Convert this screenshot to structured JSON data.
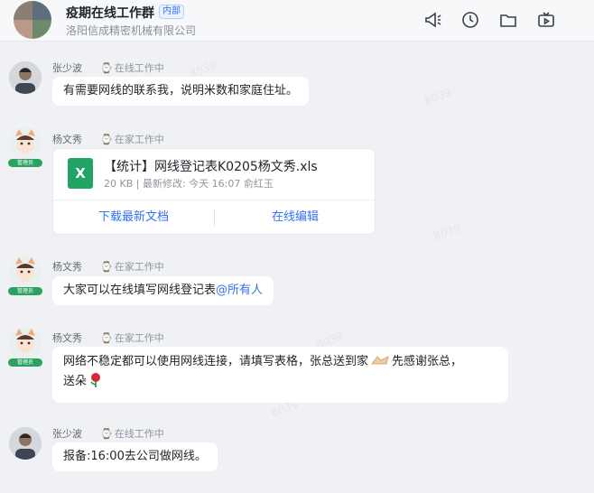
{
  "header": {
    "title": "疫期在线工作群",
    "badge": "内部",
    "subtitle": "洛阳信成精密机械有限公司",
    "icons": [
      "megaphone-icon",
      "clock-icon",
      "folder-icon",
      "tv-icon"
    ]
  },
  "messages": [
    {
      "sender": "张少波",
      "status": "在线工作中",
      "text": "有需要网线的联系我，说明米数和家庭住址。"
    },
    {
      "sender": "杨文秀",
      "status": "在家工作中",
      "file": {
        "type_label": "X",
        "name": "【统计】网线登记表K0205杨文秀.xls",
        "meta": "20 KB | 最新修改: 今天 16:07 俞红玉",
        "download": "下载最新文档",
        "edit": "在线编辑"
      }
    },
    {
      "sender": "杨文秀",
      "status": "在家工作中",
      "text": "大家可以在线填写网线登记表",
      "mention": "@所有人"
    },
    {
      "sender": "杨文秀",
      "status": "在家工作中",
      "line1": "网络不稳定都可以使用网线连接，请填写表格，张总送到家",
      "line1b": "先感谢张总，",
      "line2": "送朵"
    },
    {
      "sender": "张少波",
      "status": "在线工作中",
      "text": "报备:16:00去公司做网线。"
    }
  ],
  "avatar_badge": "管理员",
  "watermark": "8039"
}
